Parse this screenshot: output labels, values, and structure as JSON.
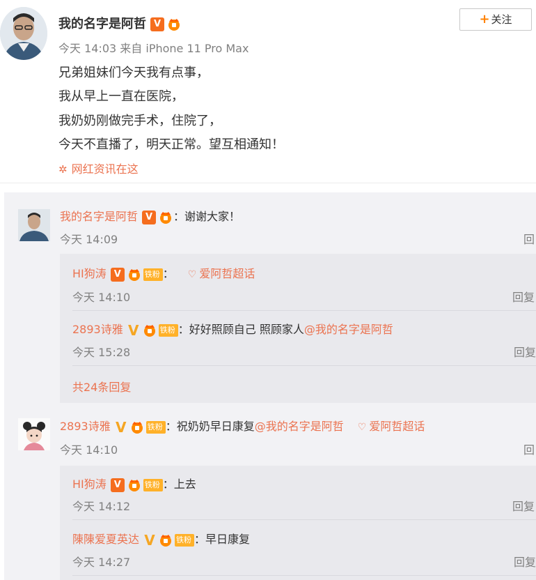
{
  "post": {
    "author": "我的名字是阿哲",
    "follow_label": "关注",
    "meta": "今天 14:03 来自 iPhone 11 Pro Max",
    "lines": [
      "兄弟姐妹们今天我有点事，",
      "我从早上一直在医院，",
      "我奶奶刚做完手术，住院了，",
      "今天不直播了，明天正常。望互相通知！"
    ],
    "topic": "网红资讯在这"
  },
  "comments": [
    {
      "user": "我的名字是阿哲",
      "text": "：谢谢大家！",
      "time": "今天 14:09",
      "reply": "回",
      "sub": [
        {
          "user": "HI狗涛",
          "text": "：",
          "topic": "爱阿哲超话",
          "time": "今天 14:10",
          "reply": "回复",
          "badge": "铁粉"
        },
        {
          "user": "2893诗雅",
          "text": "：好好照顾自己  照顾家人",
          "mention": "@我的名字是阿哲",
          "time": "今天 15:28",
          "reply": "回复",
          "badge": "铁粉"
        }
      ],
      "more": "共24条回复"
    },
    {
      "user": "2893诗雅",
      "badge": "铁粉",
      "text": "：祝奶奶早日康复",
      "mention": "@我的名字是阿哲",
      "topic": "爱阿哲超话",
      "time": "今天 14:10",
      "reply": "回",
      "sub": [
        {
          "user": "HI狗涛",
          "text": "：上去",
          "time": "今天 14:12",
          "reply": "回复",
          "badge": "铁粉"
        },
        {
          "user": "陳陳爱夏英达",
          "text": "：早日康复",
          "time": "今天 14:27",
          "reply": "回复",
          "badge": "铁粉"
        }
      ]
    }
  ],
  "colors": {
    "accent": "#eb7350",
    "vip_orange": "#f56d1e",
    "vip_gold": "#f5a623",
    "follow_plus": "#ff8200"
  },
  "icons": [
    "verified-v-icon",
    "crown-fan-icon",
    "iron-fan-badge",
    "heart-topic-icon",
    "flower-topic-icon",
    "plus-icon"
  ]
}
